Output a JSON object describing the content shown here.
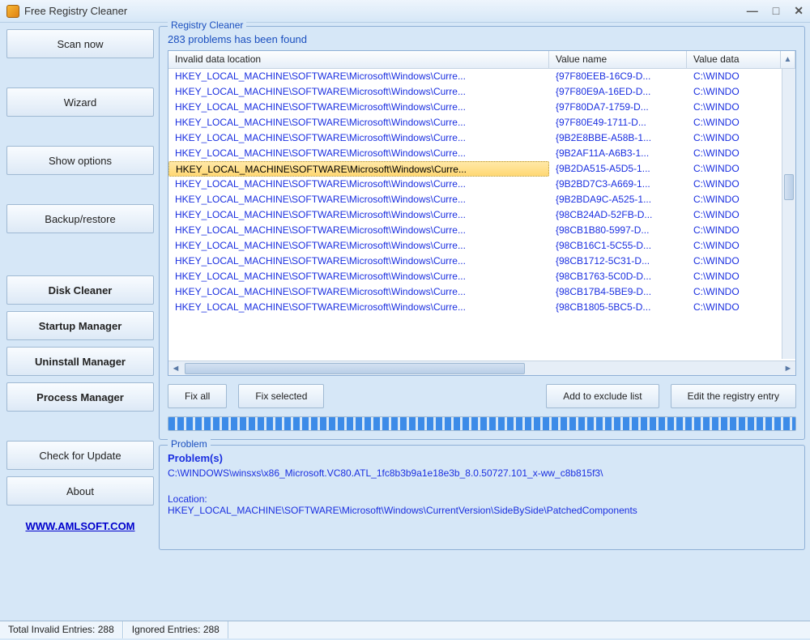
{
  "window": {
    "title": "Free Registry Cleaner"
  },
  "sidebar": {
    "scan_now": "Scan now",
    "wizard": "Wizard",
    "show_options": "Show options",
    "backup_restore": "Backup/restore",
    "disk_cleaner": "Disk Cleaner",
    "startup_manager": "Startup Manager",
    "uninstall_manager": "Uninstall Manager",
    "process_manager": "Process Manager",
    "check_update": "Check for Update",
    "about": "About",
    "link": "WWW.AMLSOFT.COM"
  },
  "registry": {
    "group_title": "Registry Cleaner",
    "found_text": "283 problems has been found",
    "columns": {
      "loc": "Invalid data location",
      "val": "Value name",
      "dat": "Value data"
    },
    "rows": [
      {
        "loc": "HKEY_LOCAL_MACHINE\\SOFTWARE\\Microsoft\\Windows\\Curre...",
        "val": "{97F80EEB-16C9-D...",
        "dat": "C:\\WINDO"
      },
      {
        "loc": "HKEY_LOCAL_MACHINE\\SOFTWARE\\Microsoft\\Windows\\Curre...",
        "val": "{97F80E9A-16ED-D...",
        "dat": "C:\\WINDO"
      },
      {
        "loc": "HKEY_LOCAL_MACHINE\\SOFTWARE\\Microsoft\\Windows\\Curre...",
        "val": "{97F80DA7-1759-D...",
        "dat": "C:\\WINDO"
      },
      {
        "loc": "HKEY_LOCAL_MACHINE\\SOFTWARE\\Microsoft\\Windows\\Curre...",
        "val": "{97F80E49-1711-D...",
        "dat": "C:\\WINDO"
      },
      {
        "loc": "HKEY_LOCAL_MACHINE\\SOFTWARE\\Microsoft\\Windows\\Curre...",
        "val": "{9B2E8BBE-A58B-1...",
        "dat": "C:\\WINDO"
      },
      {
        "loc": "HKEY_LOCAL_MACHINE\\SOFTWARE\\Microsoft\\Windows\\Curre...",
        "val": "{9B2AF11A-A6B3-1...",
        "dat": "C:\\WINDO"
      },
      {
        "loc": "HKEY_LOCAL_MACHINE\\SOFTWARE\\Microsoft\\Windows\\Curre...",
        "val": "{9B2DA515-A5D5-1...",
        "dat": "C:\\WINDO",
        "selected": true
      },
      {
        "loc": "HKEY_LOCAL_MACHINE\\SOFTWARE\\Microsoft\\Windows\\Curre...",
        "val": "{9B2BD7C3-A669-1...",
        "dat": "C:\\WINDO"
      },
      {
        "loc": "HKEY_LOCAL_MACHINE\\SOFTWARE\\Microsoft\\Windows\\Curre...",
        "val": "{9B2BDA9C-A525-1...",
        "dat": "C:\\WINDO"
      },
      {
        "loc": "HKEY_LOCAL_MACHINE\\SOFTWARE\\Microsoft\\Windows\\Curre...",
        "val": "{98CB24AD-52FB-D...",
        "dat": "C:\\WINDO"
      },
      {
        "loc": "HKEY_LOCAL_MACHINE\\SOFTWARE\\Microsoft\\Windows\\Curre...",
        "val": "{98CB1B80-5997-D...",
        "dat": "C:\\WINDO"
      },
      {
        "loc": "HKEY_LOCAL_MACHINE\\SOFTWARE\\Microsoft\\Windows\\Curre...",
        "val": "{98CB16C1-5C55-D...",
        "dat": "C:\\WINDO"
      },
      {
        "loc": "HKEY_LOCAL_MACHINE\\SOFTWARE\\Microsoft\\Windows\\Curre...",
        "val": "{98CB1712-5C31-D...",
        "dat": "C:\\WINDO"
      },
      {
        "loc": "HKEY_LOCAL_MACHINE\\SOFTWARE\\Microsoft\\Windows\\Curre...",
        "val": "{98CB1763-5C0D-D...",
        "dat": "C:\\WINDO"
      },
      {
        "loc": "HKEY_LOCAL_MACHINE\\SOFTWARE\\Microsoft\\Windows\\Curre...",
        "val": "{98CB17B4-5BE9-D...",
        "dat": "C:\\WINDO"
      },
      {
        "loc": "HKEY_LOCAL_MACHINE\\SOFTWARE\\Microsoft\\Windows\\Curre...",
        "val": "{98CB1805-5BC5-D...",
        "dat": "C:\\WINDO"
      }
    ],
    "actions": {
      "fix_all": "Fix all",
      "fix_selected": "Fix selected",
      "add_exclude": "Add to exclude list",
      "edit_entry": "Edit the registry entry"
    }
  },
  "problem": {
    "group_title": "Problem",
    "heading": "Problem(s)",
    "path": "C:\\WINDOWS\\winsxs\\x86_Microsoft.VC80.ATL_1fc8b3b9a1e18e3b_8.0.50727.101_x-ww_c8b815f3\\",
    "location_label": "Location:",
    "location_value": "HKEY_LOCAL_MACHINE\\SOFTWARE\\Microsoft\\Windows\\CurrentVersion\\SideBySide\\PatchedComponents"
  },
  "status": {
    "total_label": "Total Invalid Entries:",
    "total_value": "288",
    "ignored_label": "Ignored Entries:",
    "ignored_value": "288"
  }
}
